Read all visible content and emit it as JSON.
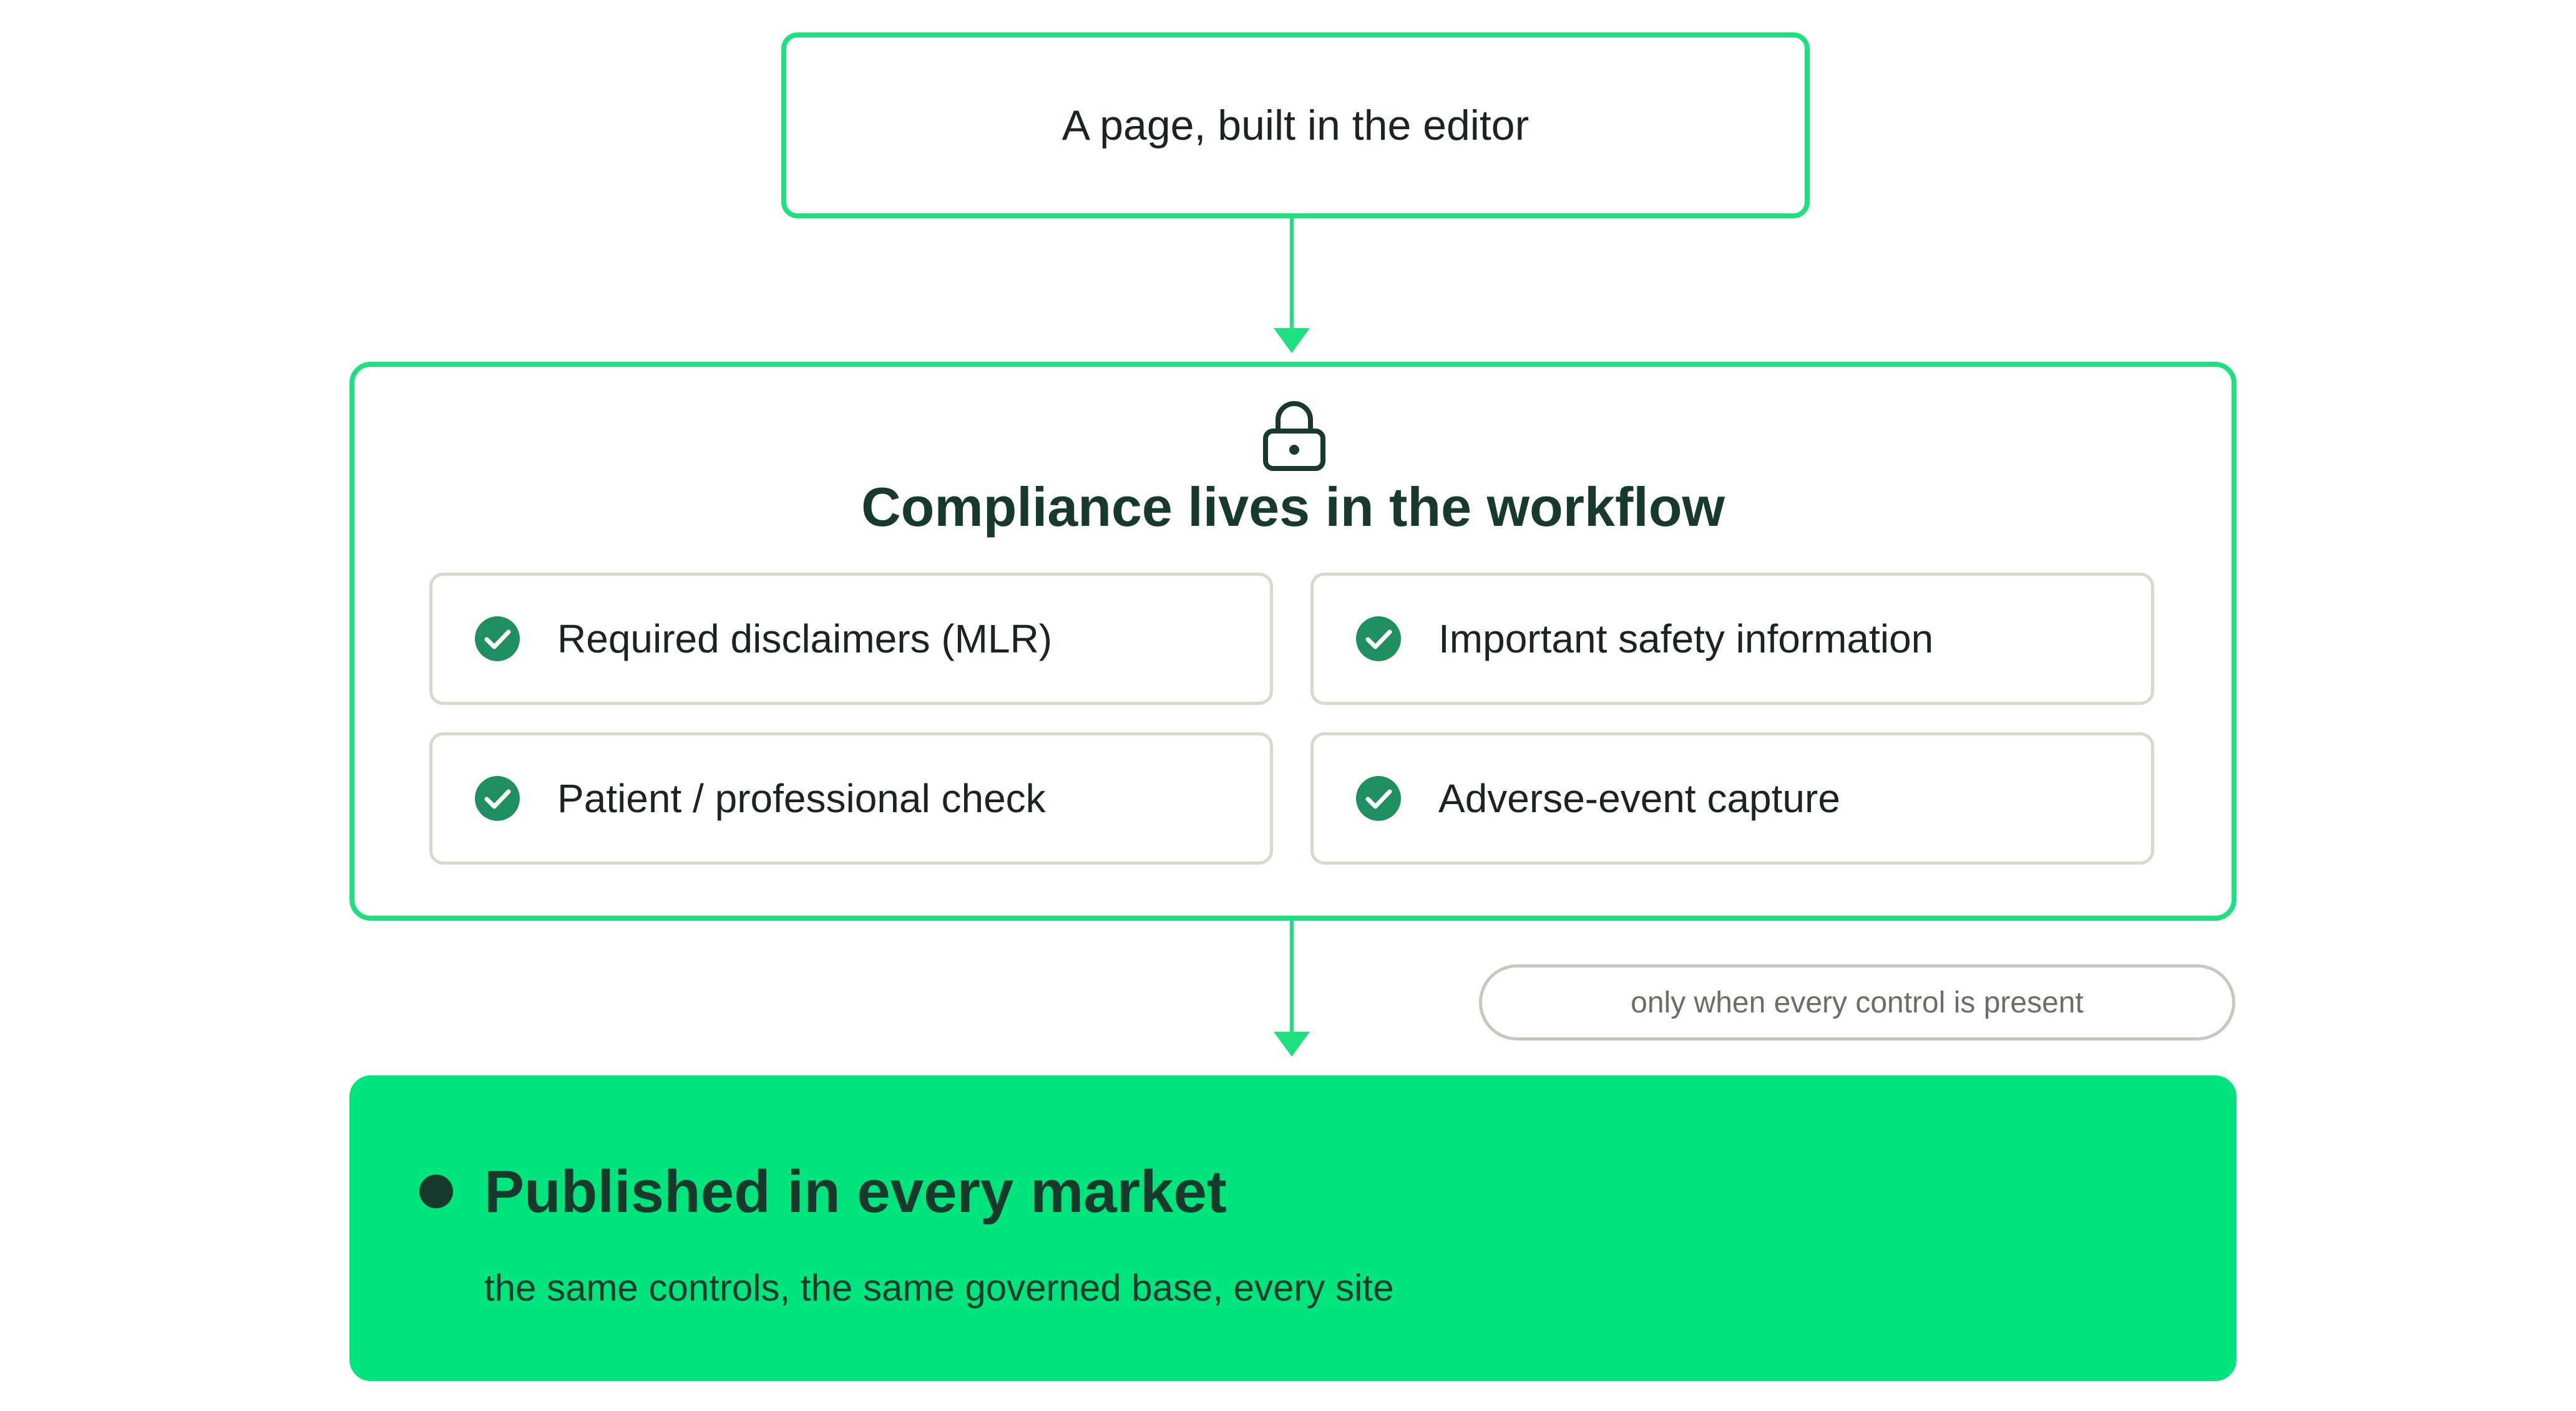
{
  "top_box": {
    "label": "A page, built in the editor"
  },
  "workflow": {
    "icon": "lock-icon",
    "title": "Compliance lives in the workflow",
    "controls": [
      {
        "label": "Required disclaimers (MLR)",
        "icon": "check-circle-icon"
      },
      {
        "label": "Important safety information",
        "icon": "check-circle-icon"
      },
      {
        "label": "Patient / professional check",
        "icon": "check-circle-icon"
      },
      {
        "label": "Adverse-event capture",
        "icon": "check-circle-icon"
      }
    ]
  },
  "condition": {
    "label": "only when every control is present"
  },
  "published": {
    "title": "Published in every market",
    "subtitle": "the same controls, the same governed base, every site"
  },
  "colors": {
    "accent_green": "#1ee07f",
    "published_fill": "#00e47e",
    "dark_green": "#173a2c",
    "check_green": "#1f8f5f",
    "card_border": "#dcd7ce",
    "pill_border": "#c9c6bf"
  }
}
